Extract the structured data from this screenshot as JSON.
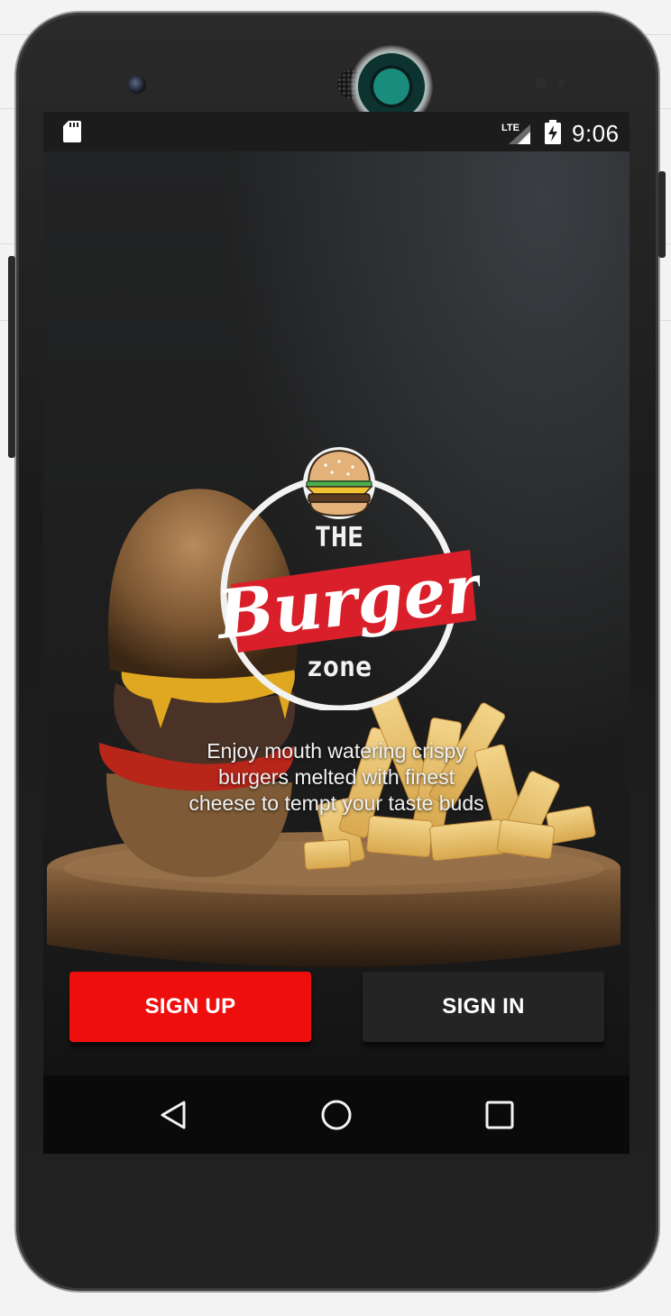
{
  "status_bar": {
    "network": "LTE",
    "time": "9:06",
    "icons": [
      "sd-card-icon",
      "lte-signal-icon",
      "battery-charging-icon"
    ]
  },
  "logo": {
    "top_text": "THE",
    "main_text": "Burger",
    "bottom_text": "zone"
  },
  "tagline": {
    "line1": "Enjoy mouth watering crispy",
    "line2": "burgers melted with finest",
    "line3": "cheese to tempt your taste buds"
  },
  "buttons": {
    "sign_up": "SIGN UP",
    "sign_in": "SIGN IN"
  },
  "nav": {
    "icons": [
      "back-icon",
      "home-icon",
      "recents-icon"
    ]
  },
  "colors": {
    "sign_up_bg": "#ef0e0e",
    "sign_in_bg": "#242424",
    "logo_red": "#d9202a",
    "emulator_record": "#1a8c7c"
  }
}
